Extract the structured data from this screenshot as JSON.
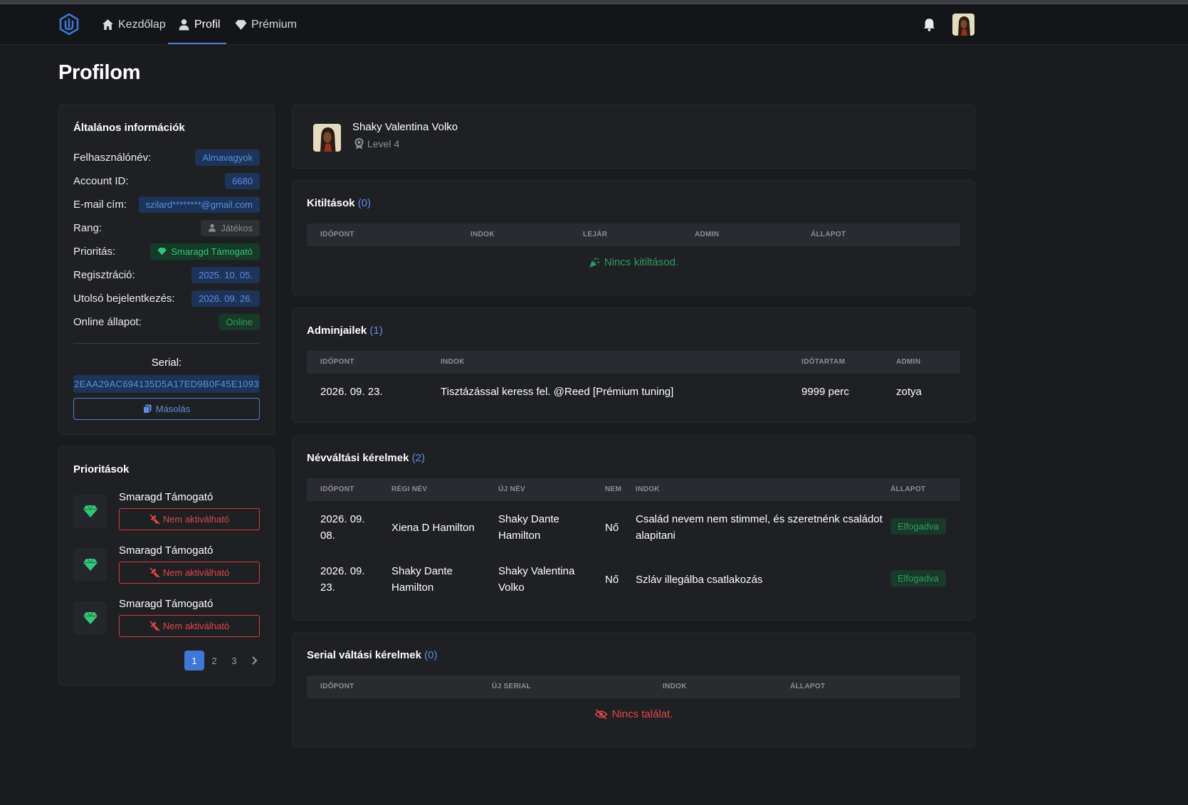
{
  "nav": {
    "items": [
      {
        "label": "Kezdőlap",
        "icon": "home-icon"
      },
      {
        "label": "Profil",
        "icon": "user-icon"
      },
      {
        "label": "Prémium",
        "icon": "diamond-icon"
      }
    ],
    "active": "Profil"
  },
  "page": {
    "title": "Profilom"
  },
  "general": {
    "title": "Általános információk",
    "rows": {
      "username": {
        "label": "Felhasználónév:",
        "value": "Almavagyok"
      },
      "account_id": {
        "label": "Account ID:",
        "value": "6680"
      },
      "email": {
        "label": "E-mail cím:",
        "value": "szilard********@gmail.com"
      },
      "rank": {
        "label": "Rang:",
        "value": "Játékos"
      },
      "priority": {
        "label": "Prioritás:",
        "value": "Smaragd Támogató"
      },
      "registration": {
        "label": "Regisztráció:",
        "value": "2025. 10. 05."
      },
      "last_login": {
        "label": "Utolsó bejelentkezés:",
        "value": "2026. 09. 26."
      },
      "online": {
        "label": "Online állapot:",
        "value": "Online"
      }
    },
    "serial_label": "Serial:",
    "serial_value": "2EAA29AC694135D5A17ED9B0F45E1093",
    "copy_label": "Másolás"
  },
  "priorities": {
    "title": "Prioritások",
    "items": [
      {
        "name": "Smaragd Támogató",
        "button": "Nem aktiválható"
      },
      {
        "name": "Smaragd Támogató",
        "button": "Nem aktiválható"
      },
      {
        "name": "Smaragd Támogató",
        "button": "Nem aktiválható"
      }
    ],
    "pages": [
      "1",
      "2",
      "3"
    ],
    "current_page": "1"
  },
  "profile": {
    "name": "Shaky Valentina Volko",
    "level": "Level 4"
  },
  "bans": {
    "title": "Kitiltások",
    "count": "(0)",
    "headers": [
      "IDŐPONT",
      "INDOK",
      "LEJÁR",
      "ADMIN",
      "ÁLLAPOT"
    ],
    "empty": "Nincs kitiltásod."
  },
  "adminjails": {
    "title": "Adminjailek",
    "count": "(1)",
    "headers": [
      "IDŐPONT",
      "INDOK",
      "IDŐTARTAM",
      "ADMIN"
    ],
    "rows": [
      {
        "date": "2026. 09. 23.",
        "reason": "Tisztázással keress fel. @Reed [Prémium tuning]",
        "duration": "9999 perc",
        "admin": "zotya"
      }
    ]
  },
  "namechanges": {
    "title": "Névváltási kérelmek",
    "count": "(2)",
    "headers": [
      "IDŐPONT",
      "RÉGI NÉV",
      "ÚJ NÉV",
      "NEM",
      "INDOK",
      "ÁLLAPOT"
    ],
    "rows": [
      {
        "date_l1": "2026. 09.",
        "date_l2": "08.",
        "old_l1": "Xiena D Hamilton",
        "old_l2": "",
        "new_l1": "Shaky Dante",
        "new_l2": "Hamilton",
        "gender": "Nő",
        "reason_l1": "Család nevem nem stimmel, és szeretnénk családot",
        "reason_l2": "alapitani",
        "status": "Elfogadva"
      },
      {
        "date_l1": "2026. 09.",
        "date_l2": "23.",
        "old_l1": "Shaky Dante",
        "old_l2": "Hamilton",
        "new_l1": "Shaky Valentina",
        "new_l2": "Volko",
        "gender": "Nő",
        "reason_l1": "Szláv illegálba csatlakozás",
        "reason_l2": "",
        "status": "Elfogadva"
      }
    ]
  },
  "serialchanges": {
    "title": "Serial váltási kérelmek",
    "count": "(0)",
    "headers": [
      "IDŐPONT",
      "ÚJ SERIAL",
      "INDOK",
      "ÁLLAPOT"
    ],
    "empty": "Nincs találat."
  },
  "colors": {
    "accent": "#4a7fd4",
    "success": "#34c77b",
    "danger": "#e04848",
    "background": "#1a1b1f",
    "card": "#1f2024"
  }
}
